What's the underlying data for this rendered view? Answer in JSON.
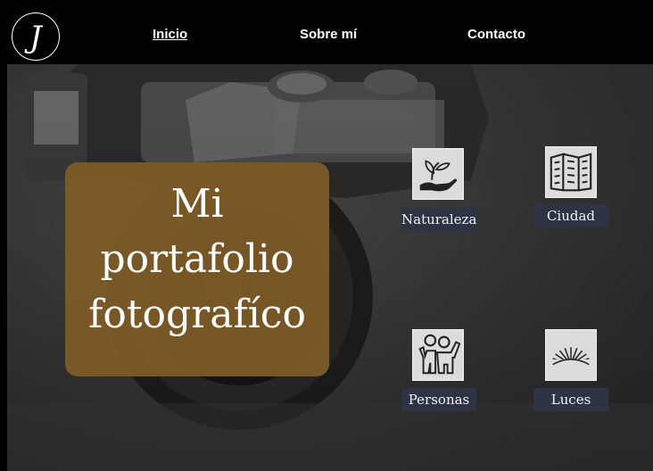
{
  "logo": {
    "letter": "J"
  },
  "nav": [
    {
      "label": "Inicio",
      "active": true
    },
    {
      "label": "Sobre mí",
      "active": false
    },
    {
      "label": "Contacto",
      "active": false
    }
  ],
  "hero": {
    "title_lines": [
      "Mi",
      "portafolio",
      "fotografíco"
    ]
  },
  "categories": [
    {
      "label": "Naturaleza",
      "icon": "plant-hand-icon"
    },
    {
      "label": "Ciudad",
      "icon": "building-icon"
    },
    {
      "label": "Personas",
      "icon": "people-icon"
    },
    {
      "label": "Luces",
      "icon": "light-rays-icon"
    }
  ],
  "colors": {
    "topbar": "#000000",
    "title_card": "#7f5c28",
    "label_bg": "#2e3444",
    "text": "#ffffff"
  }
}
